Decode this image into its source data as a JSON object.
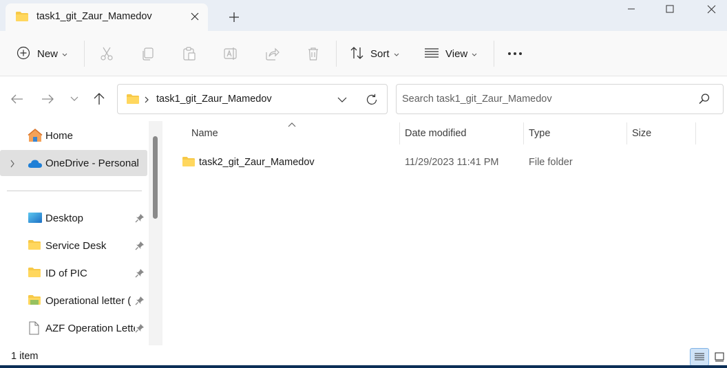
{
  "window": {
    "tab_title": "task1_git_Zaur_Mamedov",
    "tab_icon": "folder-icon"
  },
  "toolbar": {
    "new_label": "New",
    "sort_label": "Sort",
    "view_label": "View",
    "icons": [
      "cut-icon",
      "copy-icon",
      "paste-icon",
      "rename-icon",
      "share-icon",
      "delete-icon",
      "see-more-icon"
    ]
  },
  "address": {
    "path": "task1_git_Zaur_Mamedov"
  },
  "search": {
    "placeholder": "Search task1_git_Zaur_Mamedov"
  },
  "sidebar": {
    "items": [
      {
        "label": "Home",
        "icon": "home-icon"
      },
      {
        "label": "OneDrive - Personal",
        "icon": "cloud-icon",
        "selected": true
      },
      {
        "label": "Desktop",
        "icon": "desktop-icon",
        "pinned": true
      },
      {
        "label": "Service Desk",
        "icon": "folder-icon",
        "pinned": true
      },
      {
        "label": "ID of PIC",
        "icon": "folder-icon",
        "pinned": true
      },
      {
        "label": "Operational letter (",
        "icon": "folder-icon",
        "pinned": true
      },
      {
        "label": "AZF Operation Lette",
        "icon": "file-icon",
        "pinned": true
      }
    ]
  },
  "columns": {
    "name": "Name",
    "date": "Date modified",
    "type": "Type",
    "size": "Size"
  },
  "files": [
    {
      "name": "task2_git_Zaur_Mamedov",
      "date": "11/29/2023 11:41 PM",
      "type": "File folder",
      "size": ""
    }
  ],
  "status": {
    "count": "1 item"
  },
  "colors": {
    "folder_yellow": "#f7c948",
    "accent_blue": "#0067c0",
    "onedrive_blue": "#1f7fd6",
    "selection_gray": "#e0e0e0"
  }
}
